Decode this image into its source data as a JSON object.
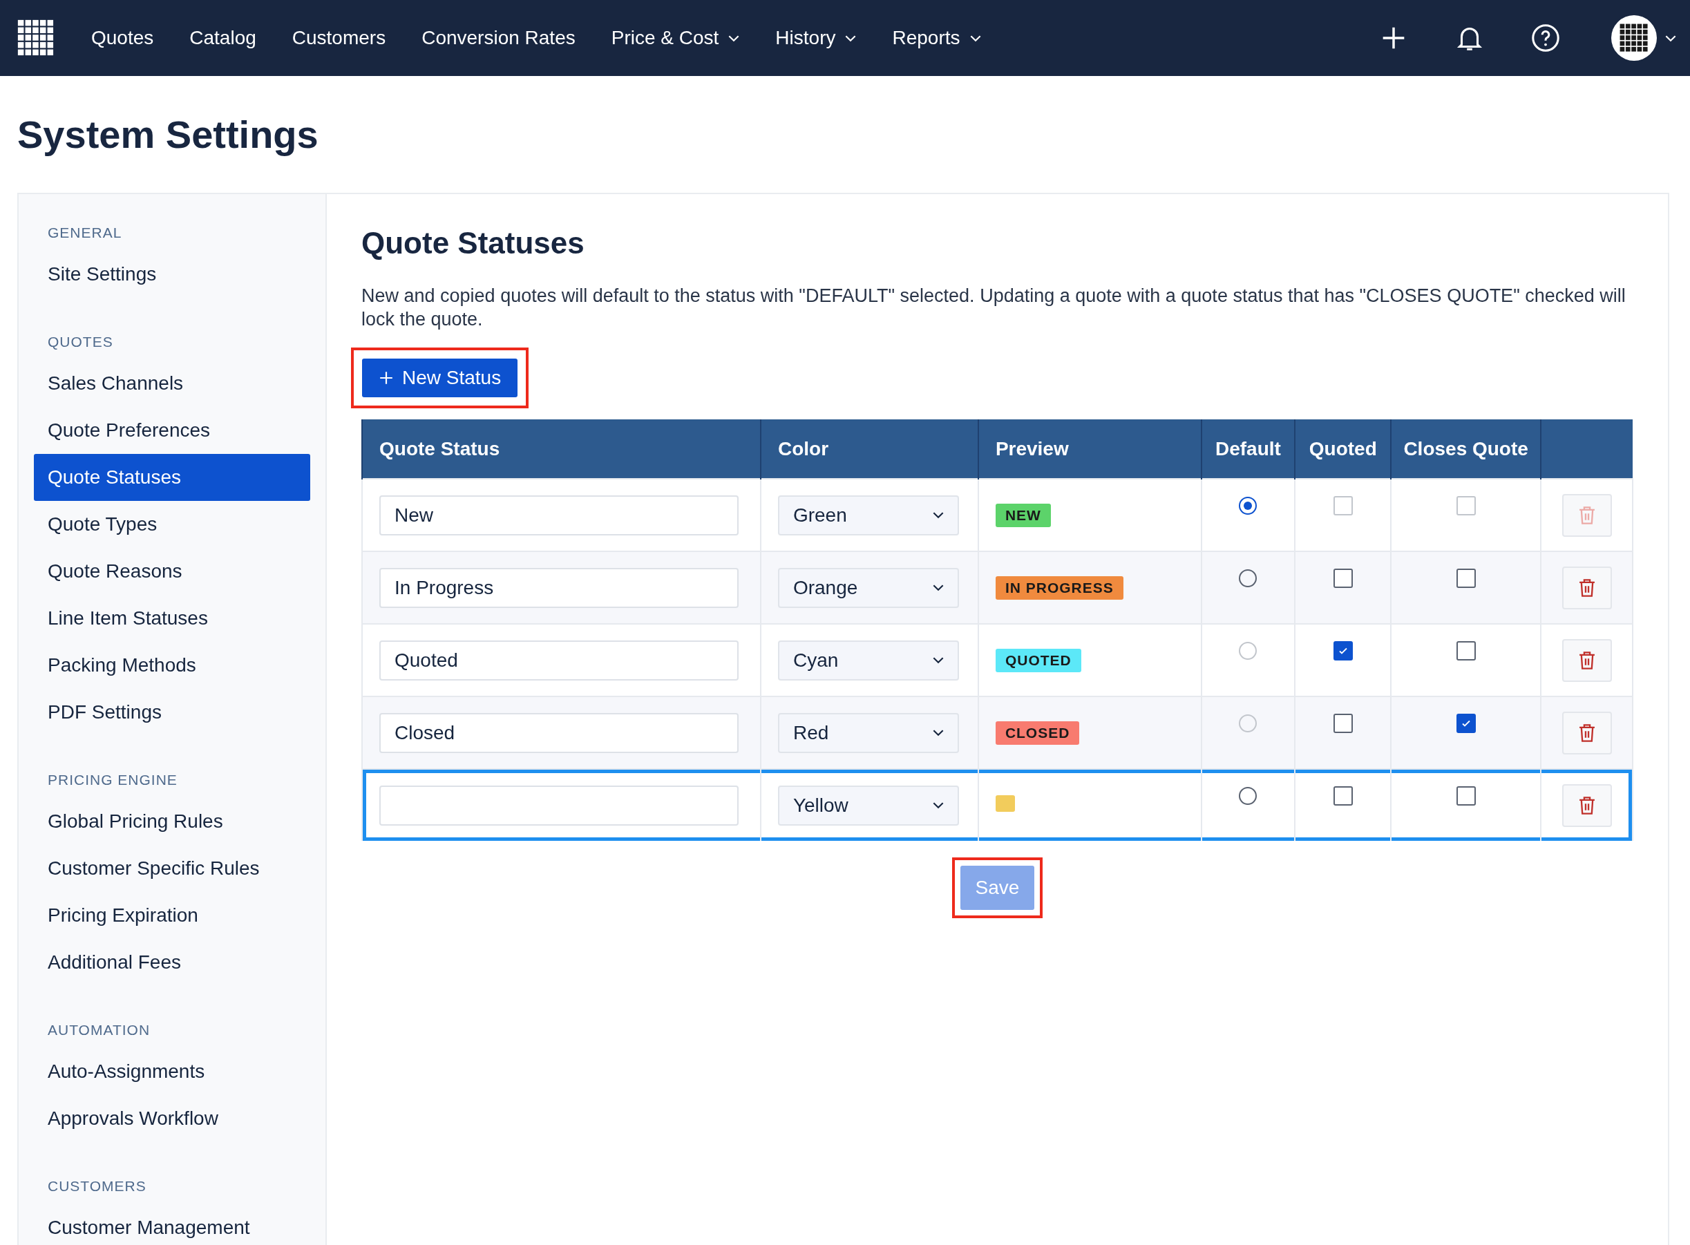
{
  "nav": {
    "items": [
      {
        "label": "Quotes",
        "dropdown": false
      },
      {
        "label": "Catalog",
        "dropdown": false
      },
      {
        "label": "Customers",
        "dropdown": false
      },
      {
        "label": "Conversion Rates",
        "dropdown": false
      },
      {
        "label": "Price & Cost",
        "dropdown": true
      },
      {
        "label": "History",
        "dropdown": true
      },
      {
        "label": "Reports",
        "dropdown": true
      }
    ]
  },
  "page_title": "System Settings",
  "sidebar": {
    "sections": [
      {
        "heading": "GENERAL",
        "items": [
          {
            "label": "Site Settings",
            "selected": false
          }
        ]
      },
      {
        "heading": "QUOTES",
        "items": [
          {
            "label": "Sales Channels",
            "selected": false
          },
          {
            "label": "Quote Preferences",
            "selected": false
          },
          {
            "label": "Quote Statuses",
            "selected": true
          },
          {
            "label": "Quote Types",
            "selected": false
          },
          {
            "label": "Quote Reasons",
            "selected": false
          },
          {
            "label": "Line Item Statuses",
            "selected": false
          },
          {
            "label": "Packing Methods",
            "selected": false
          },
          {
            "label": "PDF Settings",
            "selected": false
          }
        ]
      },
      {
        "heading": "PRICING ENGINE",
        "items": [
          {
            "label": "Global Pricing Rules",
            "selected": false
          },
          {
            "label": "Customer Specific Rules",
            "selected": false
          },
          {
            "label": "Pricing Expiration",
            "selected": false
          },
          {
            "label": "Additional Fees",
            "selected": false
          }
        ]
      },
      {
        "heading": "AUTOMATION",
        "items": [
          {
            "label": "Auto-Assignments",
            "selected": false
          },
          {
            "label": "Approvals Workflow",
            "selected": false
          }
        ]
      },
      {
        "heading": "CUSTOMERS",
        "items": [
          {
            "label": "Customer Management",
            "selected": false
          }
        ]
      }
    ]
  },
  "content": {
    "title": "Quote Statuses",
    "description": "New and copied quotes will default to the status with \"DEFAULT\" selected. Updating a quote with a quote status that has \"CLOSES QUOTE\" checked will lock the quote.",
    "new_status_button": {
      "label": "New Status",
      "annotated": true
    },
    "table": {
      "columns": [
        "Quote Status",
        "Color",
        "Preview",
        "Default",
        "Quoted",
        "Closes Quote"
      ],
      "rows": [
        {
          "name": "New",
          "color_label": "Green",
          "color": "#5cd36a",
          "preview": "NEW",
          "default": true,
          "default_disabled": false,
          "quoted": false,
          "quoted_disabled": true,
          "closes_quote": false,
          "closes_disabled": true,
          "delete_disabled": true,
          "annotated": false
        },
        {
          "name": "In Progress",
          "color_label": "Orange",
          "color": "#f08a3e",
          "preview": "IN PROGRESS",
          "default": false,
          "default_disabled": false,
          "quoted": false,
          "quoted_disabled": false,
          "closes_quote": false,
          "closes_disabled": false,
          "delete_disabled": false,
          "annotated": false
        },
        {
          "name": "Quoted",
          "color_label": "Cyan",
          "color": "#5ce8f8",
          "preview": "QUOTED",
          "default": false,
          "default_disabled": true,
          "quoted": true,
          "quoted_disabled": false,
          "closes_quote": false,
          "closes_disabled": false,
          "delete_disabled": false,
          "annotated": false
        },
        {
          "name": "Closed",
          "color_label": "Red",
          "color": "#f87b6f",
          "preview": "CLOSED",
          "default": false,
          "default_disabled": true,
          "quoted": false,
          "quoted_disabled": false,
          "closes_quote": true,
          "closes_disabled": false,
          "delete_disabled": false,
          "annotated": false
        },
        {
          "color_label": "Yellow",
          "color": "#f2cc5c",
          "default": false,
          "default_disabled": false,
          "quoted": false,
          "quoted_disabled": false,
          "closes_quote": false,
          "closes_disabled": false,
          "delete_disabled": false,
          "annotated": true
        }
      ]
    },
    "save_button": {
      "label": "Save",
      "disabled": true,
      "annotated": true
    }
  }
}
